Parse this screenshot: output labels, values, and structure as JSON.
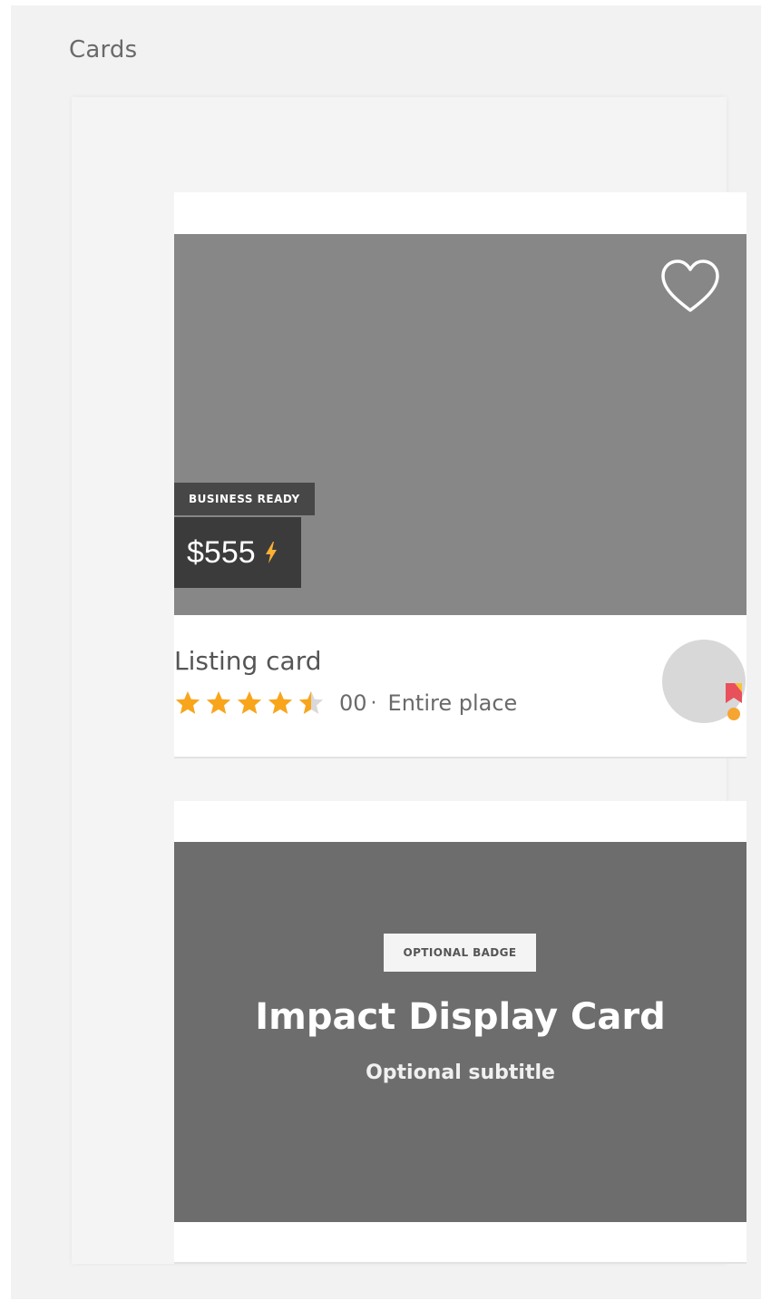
{
  "page": {
    "section_title": "Cards"
  },
  "listing_card": {
    "badge": "BUSINESS READY",
    "price": "$555",
    "title": "Listing card",
    "rating": 4.5,
    "rating_max": 5,
    "review_count": "00",
    "separator": "·",
    "place_type": "Entire place",
    "icons": {
      "favorite": "heart-outline-icon",
      "instant_book": "lightning-bolt-icon",
      "host": "superhost-ribbon-icon"
    }
  },
  "impact_card": {
    "badge": "OPTIONAL BADGE",
    "title": "Impact Display Card",
    "subtitle": "Optional subtitle"
  },
  "colors": {
    "star": "#f8a51c",
    "bolt": "#fbb034",
    "ribbon_red": "#e8505b",
    "ribbon_yellow": "#f7c33a",
    "listing_image": "#878787",
    "impact_image": "#6d6d6d"
  }
}
